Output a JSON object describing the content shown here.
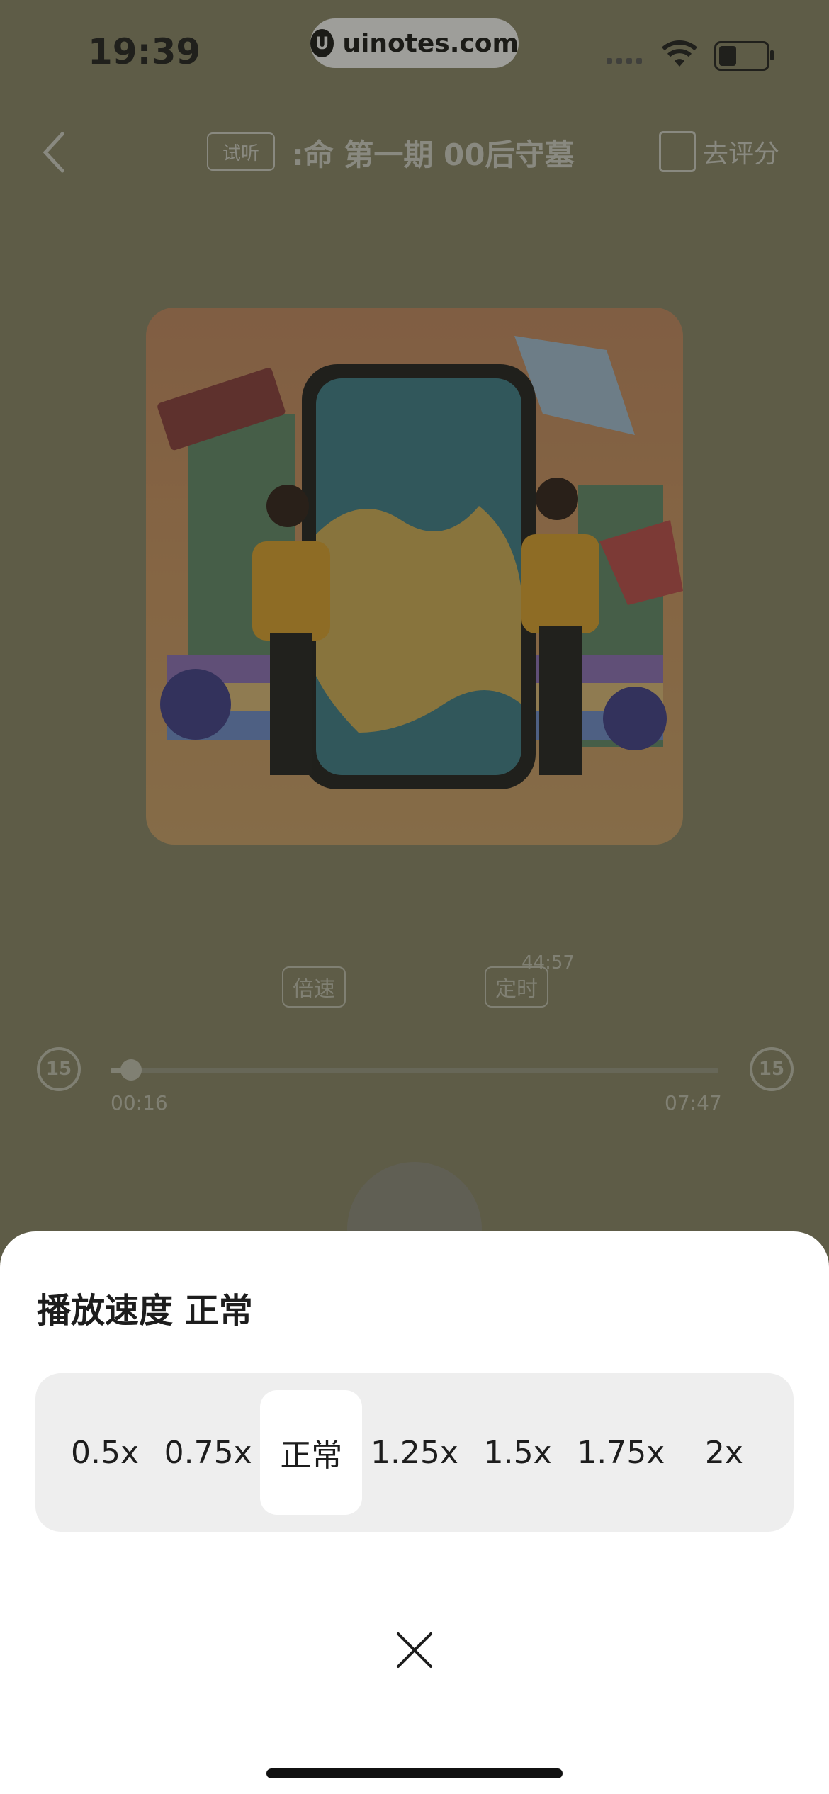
{
  "status_bar": {
    "time": "19:39",
    "site": "uinotes.com"
  },
  "nav": {
    "trial_tag": "试听",
    "title": ":命     第一期 00后守墓",
    "rate_label": "去评分"
  },
  "controls": {
    "speed_label": "倍速",
    "timer_label": "定时",
    "timer_remaining": "44:57"
  },
  "progress": {
    "current": "00:16",
    "total": "07:47",
    "fraction": 0.034,
    "skip_back": "15",
    "skip_forward": "15"
  },
  "sheet": {
    "title": "播放速度 正常",
    "options": [
      "0.5x",
      "0.75x",
      "正常",
      "1.25x",
      "1.5x",
      "1.75x",
      "2x"
    ],
    "selected": "正常"
  },
  "colors": {
    "accent": "#ffffff",
    "overlay": "#5b5b48"
  }
}
